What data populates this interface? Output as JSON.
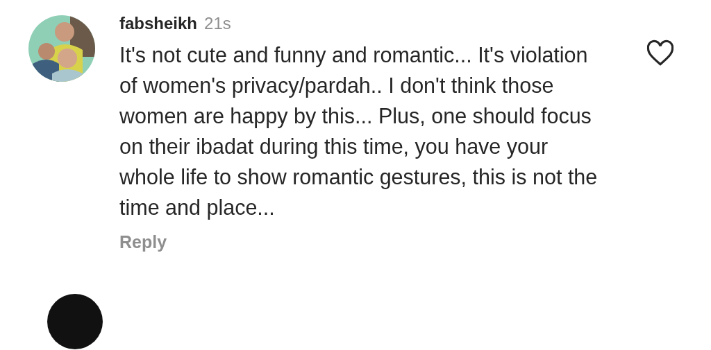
{
  "comments": [
    {
      "username": "fabsheikh",
      "time": "21s",
      "text": "It's not cute and funny and romantic... It's violation of women's privacy/pardah.. I don't think those women are happy by this... Plus, one should focus on their ibadat during this time, you have your whole life to show romantic gestures, this is not the time and place...",
      "liked": false,
      "reply": "Reply"
    }
  ]
}
